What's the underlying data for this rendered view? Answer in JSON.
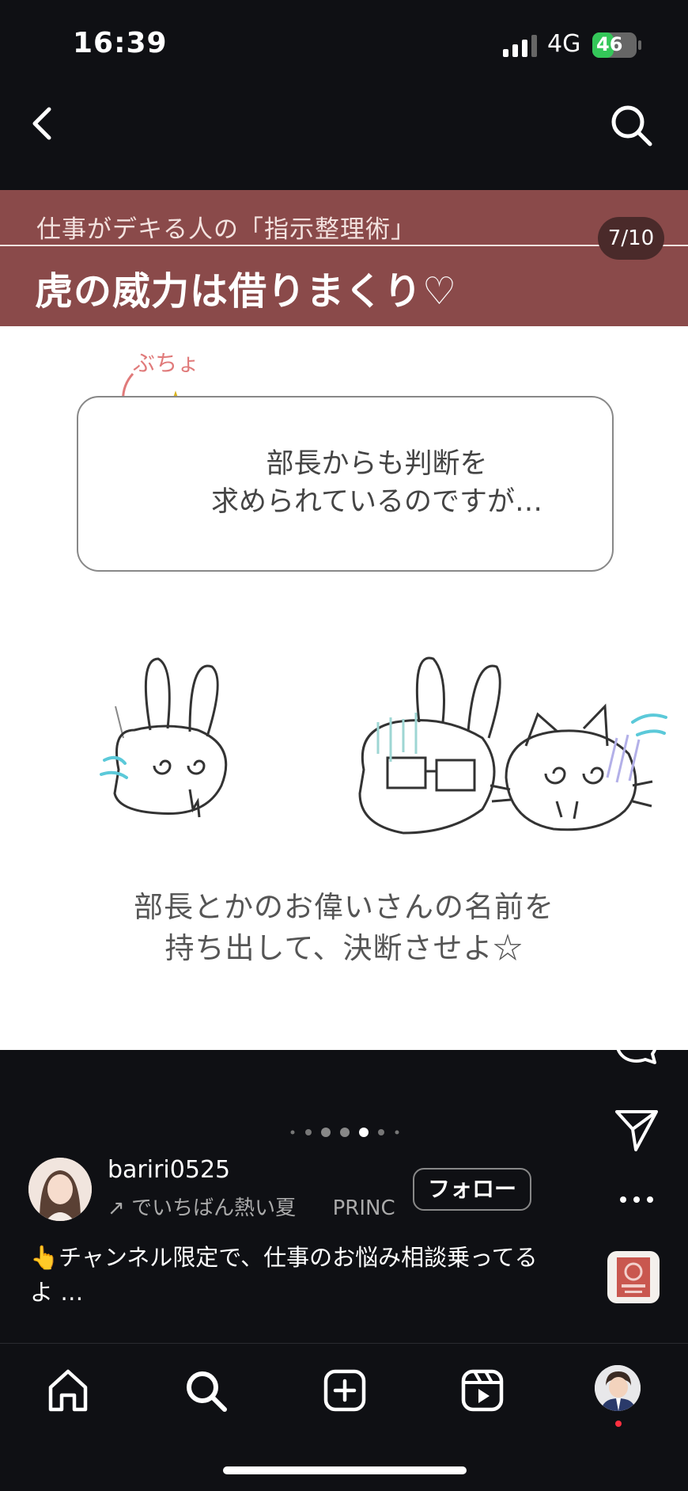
{
  "status_bar": {
    "time": "16:39",
    "network": "4G",
    "battery": "46"
  },
  "post": {
    "banner_subtitle": "仕事がデキる人の「指示整理術」",
    "banner_title": "虎の威力は借りまくり♡",
    "page_counter": "7/10",
    "sfx_label": "ぶちょ",
    "bubble_text_line1": "部長からも判断を",
    "bubble_text_line2": "求められているのですが…",
    "caption_line1": "部長とかのお偉いさんの名前を",
    "caption_line2": "持ち出して、決断させよ☆"
  },
  "actions": {
    "like_count": ""
  },
  "carousel": {
    "dot_count": 7,
    "active_index": 4
  },
  "author": {
    "username": "bariri0525",
    "audio_title": "でいちばん熱い夏",
    "audio_artist": "PRINC",
    "follow_label": "フォロー"
  },
  "caption": {
    "text_line1": "👆チャンネル限定で、仕事のお悩み相談乗ってる",
    "text_line2": "よ …"
  },
  "icons": {
    "back": "chevron-left-icon",
    "search": "search-icon",
    "like": "heart-icon",
    "comment": "comment-icon",
    "share": "send-icon",
    "more": "more-horizontal-icon",
    "home": "home-icon",
    "create": "plus-square-icon",
    "reels": "reels-icon"
  },
  "colors": {
    "banner": "#8a4a4a",
    "background": "#0f1014",
    "battery_green": "#34c759",
    "notification": "#ff3040"
  }
}
